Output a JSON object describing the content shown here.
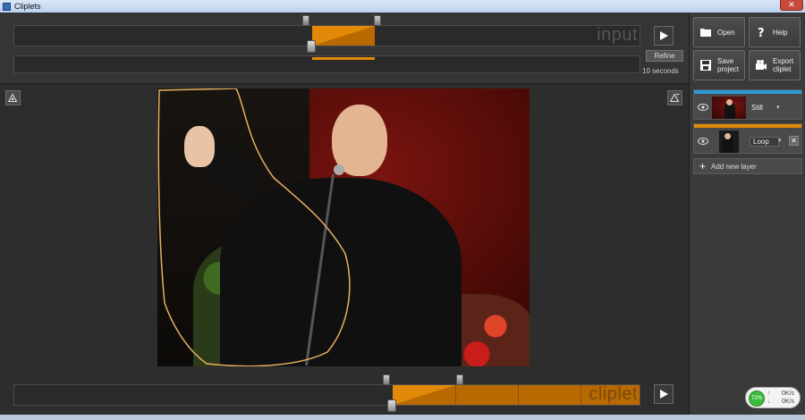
{
  "window": {
    "title": "Cliplets",
    "close_label": "✕"
  },
  "input_timeline": {
    "watermark": "input"
  },
  "cliplet_timeline": {
    "watermark": "cliplet"
  },
  "refine": {
    "label": "Refine",
    "duration": "10 seconds"
  },
  "toolbar": {
    "open_label": "Open",
    "help_label": "Help",
    "save_label": "Save project",
    "export_label": "Export cliplet"
  },
  "layers": [
    {
      "mode": "Still",
      "stripe_color": "#2f9bd8"
    },
    {
      "mode": "Loop",
      "stripe_color": "#e28a08"
    }
  ],
  "add_layer": {
    "label": "Add new layer"
  },
  "network": {
    "percent": "72%",
    "up_rate": "0K/s",
    "down_rate": "0K/s"
  },
  "colors": {
    "accent_orange": "#e28a08",
    "accent_blue": "#2f9bd8",
    "selection_outline": "#e8b060"
  }
}
